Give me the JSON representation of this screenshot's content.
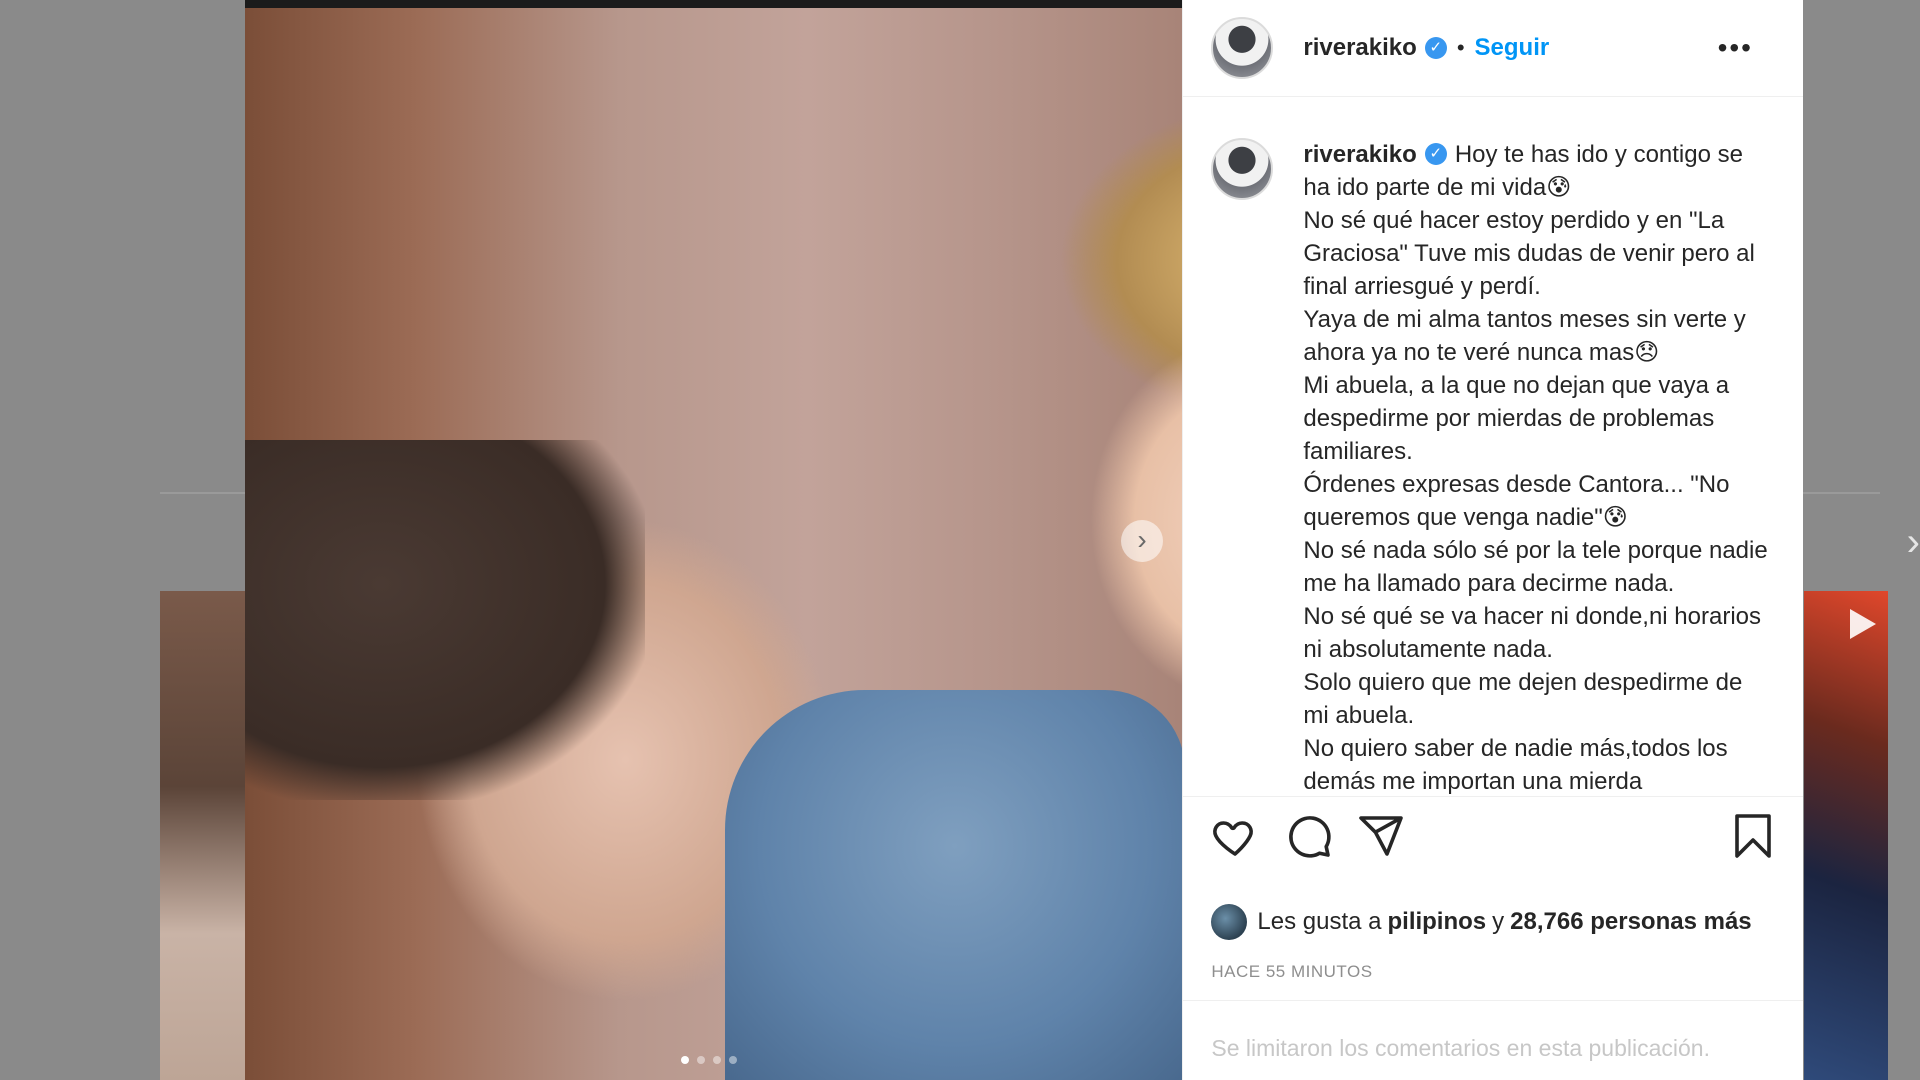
{
  "post": {
    "username": "riverakiko",
    "follow_label": "Seguir",
    "separator": "•",
    "more_label": "•••",
    "caption_lines": [
      "Hoy te has ido y contigo se ha ido parte de mi vida😰",
      "No sé qué hacer estoy perdido y en \"La Graciosa\" Tuve mis dudas de venir pero al final arriesgué y perdí.",
      "Yaya de mi alma tantos meses sin verte y ahora ya no te veré nunca mas😞",
      "Mi abuela, a la que no dejan que vaya a despedirme por mierdas de problemas familiares.",
      "Órdenes expresas desde Cantora... \"No queremos que venga nadie\"😰",
      "No sé nada sólo sé por la tele porque nadie me ha llamado para decirme nada.",
      "No sé qué se va hacer ni donde,ni horarios ni absolutamente nada.",
      "Solo quiero que me dejen despedirme de mi abuela.",
      "No quiero saber de nadie más,todos los demás me importan una mierda"
    ],
    "likes_prefix": "Les gusta a",
    "liked_by": "pilipinos",
    "likes_join": "y",
    "likes_count": "28,766 personas más",
    "timestamp": "HACE 55 MINUTOS",
    "comments_notice": "Se limitaron los comentarios en esta publicación.",
    "carousel": {
      "total": 4,
      "current": 1
    }
  },
  "icons": {
    "like": "heart-icon",
    "comment": "comment-bubble-icon",
    "share": "paper-plane-icon",
    "save": "bookmark-icon",
    "verified": "verified-badge-icon",
    "next": "chevron-right-icon"
  },
  "colors": {
    "follow": "#0095f6",
    "verified": "#3897f0",
    "text": "#262626",
    "muted": "#8e8e8e"
  }
}
